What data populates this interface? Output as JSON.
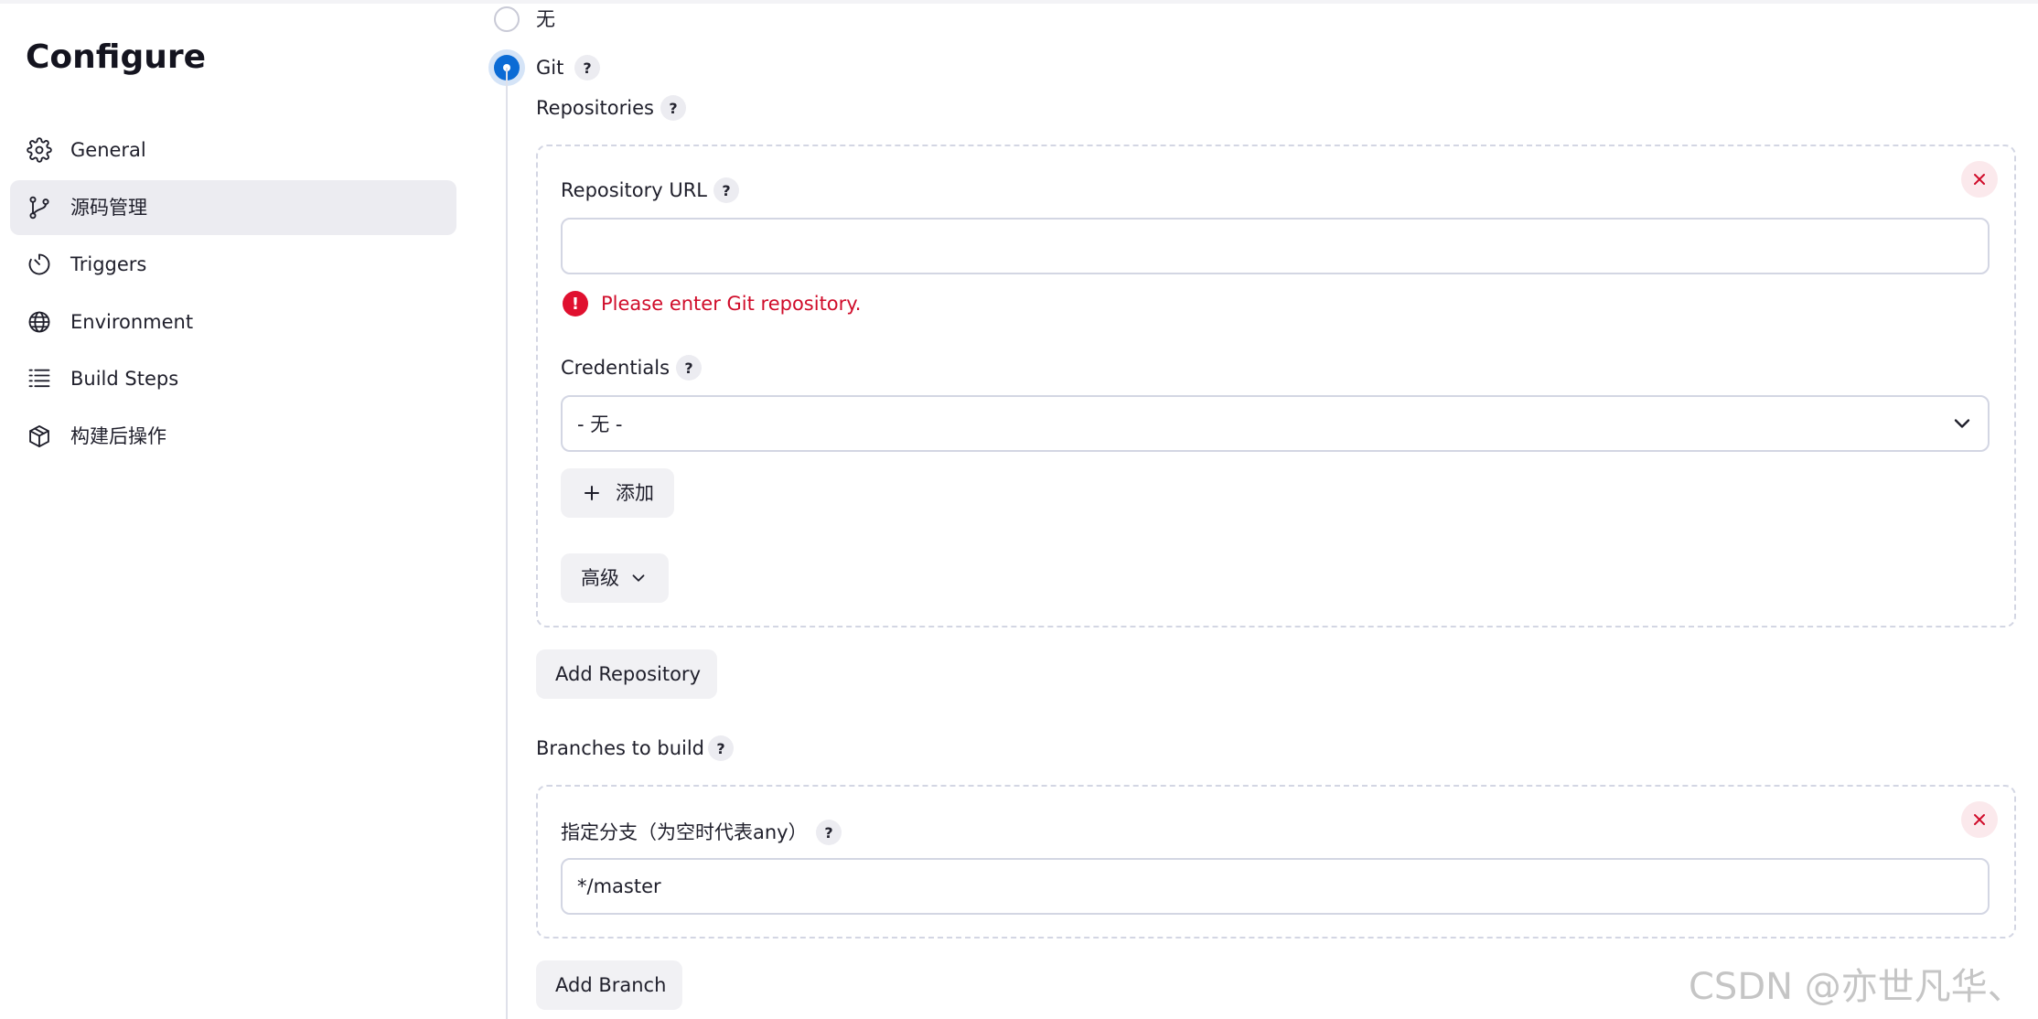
{
  "sidebar": {
    "title": "Configure",
    "items": [
      {
        "label": "General",
        "icon": "gear-icon"
      },
      {
        "label": "源码管理",
        "icon": "branch-icon",
        "active": true
      },
      {
        "label": "Triggers",
        "icon": "timer-icon"
      },
      {
        "label": "Environment",
        "icon": "globe-icon"
      },
      {
        "label": "Build Steps",
        "icon": "list-icon"
      },
      {
        "label": "构建后操作",
        "icon": "package-icon"
      }
    ]
  },
  "scm": {
    "options": [
      {
        "label": "无",
        "selected": false
      },
      {
        "label": "Git",
        "selected": true
      }
    ],
    "help_glyph": "?",
    "repositories_label": "Repositories",
    "repo_url_label": "Repository URL",
    "repo_url_value": "",
    "repo_url_error": "Please enter Git repository.",
    "error_glyph": "!",
    "credentials_label": "Credentials",
    "credentials_value": "- 无 -",
    "add_credentials_label": "添加",
    "advanced_label": "高级",
    "add_repository_label": "Add Repository",
    "branches_label": "Branches to build",
    "branch_specifier_label": "指定分支（为空时代表any）",
    "branch_specifier_value": "*/master",
    "add_branch_label": "Add Branch"
  },
  "watermark": "CSDN @亦世凡华、",
  "colors": {
    "accent": "#0b6bd5",
    "error": "#d00c2a",
    "active_nav_bg": "#ececf1"
  }
}
